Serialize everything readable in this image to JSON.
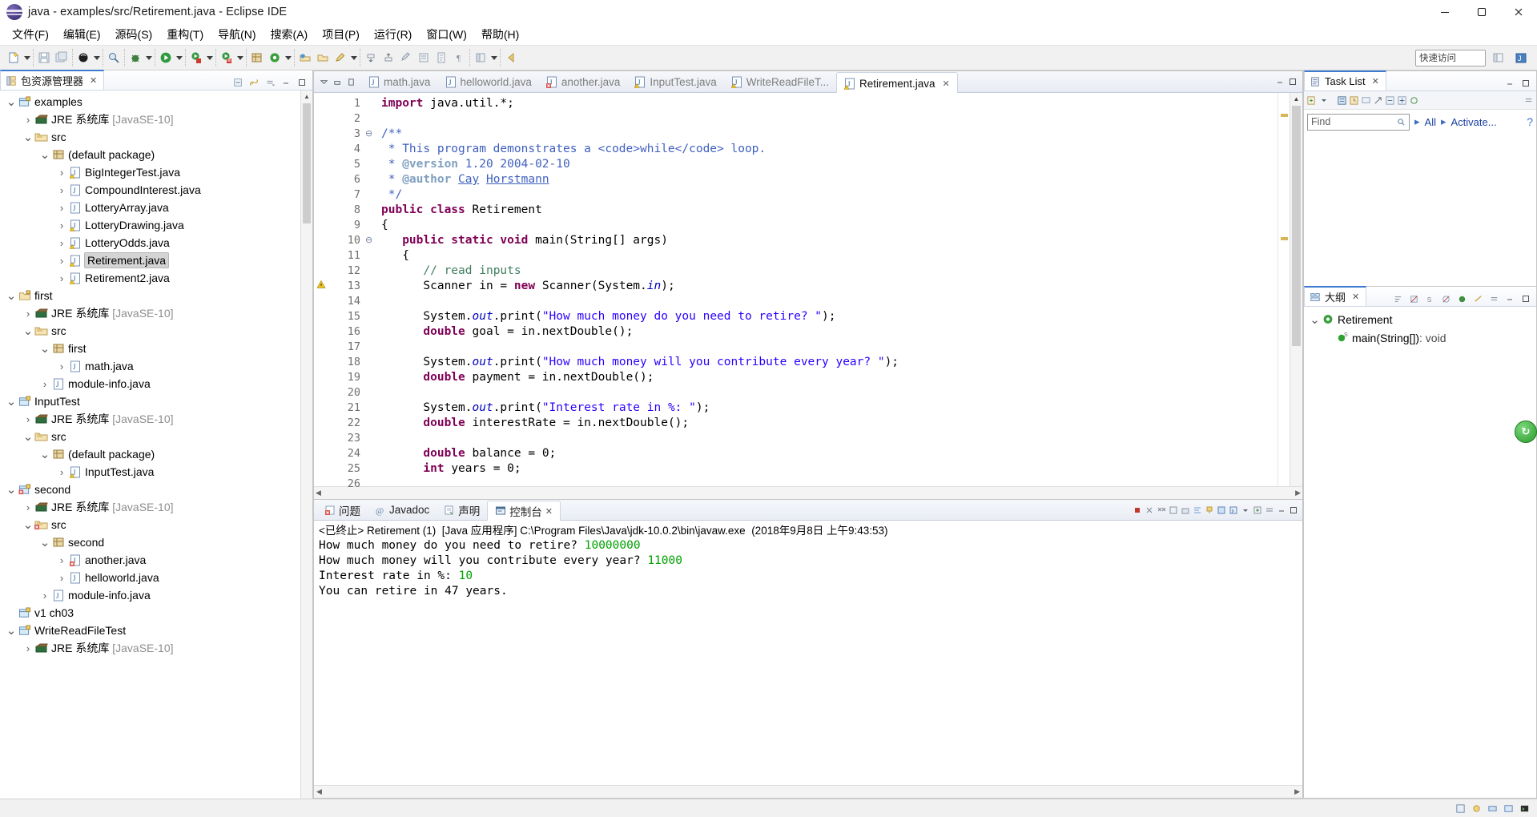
{
  "window": {
    "title": "java - examples/src/Retirement.java - Eclipse IDE",
    "minimize": "–",
    "maximize": "❐",
    "close": "✕"
  },
  "menubar": {
    "items": [
      {
        "label": "文件(F)"
      },
      {
        "label": "编辑(E)"
      },
      {
        "label": "源码(S)"
      },
      {
        "label": "重构(T)"
      },
      {
        "label": "导航(N)"
      },
      {
        "label": "搜索(A)"
      },
      {
        "label": "项目(P)"
      },
      {
        "label": "运行(R)"
      },
      {
        "label": "窗口(W)"
      },
      {
        "label": "帮助(H)"
      }
    ]
  },
  "toolbar": {
    "quick_access": "快速访问",
    "icons": [
      "new-wizard-icon",
      "save-icon",
      "save-all-icon",
      "print-icon",
      "new-java-package-icon",
      "debug-icon",
      "run-icon",
      "coverage-icon",
      "external-tools-icon",
      "new-class-icon",
      "refresh-icon",
      "open-type-icon",
      "search-icon",
      "annotation-icon",
      "previous-annotation-icon",
      "next-annotation-icon",
      "last-edit-icon",
      "back-icon",
      "forward-icon",
      "pin-editor-icon"
    ]
  },
  "explorer": {
    "tab_label": "包资源管理器",
    "tab_close": "✕",
    "tools": [
      "collapse-all-icon",
      "link-with-editor-icon",
      "view-menu-icon",
      "minimize-icon",
      "maximize-icon"
    ],
    "tree": [
      {
        "depth": 0,
        "twist": "⌄",
        "icon": "project-icon",
        "label": "examples",
        "suffix": "",
        "selected": false
      },
      {
        "depth": 1,
        "twist": "›",
        "icon": "jre-library-icon",
        "label": "JRE 系统库",
        "suffix": "[JavaSE-10]",
        "selected": false
      },
      {
        "depth": 1,
        "twist": "⌄",
        "icon": "source-folder-icon",
        "label": "src",
        "suffix": "",
        "selected": false
      },
      {
        "depth": 2,
        "twist": "⌄",
        "icon": "package-icon",
        "label": "(default package)",
        "suffix": "",
        "selected": false
      },
      {
        "depth": 3,
        "twist": "›",
        "icon": "java-file-warn-icon",
        "label": "BigIntegerTest.java",
        "suffix": "",
        "selected": false
      },
      {
        "depth": 3,
        "twist": "›",
        "icon": "java-file-icon",
        "label": "CompoundInterest.java",
        "suffix": "",
        "selected": false
      },
      {
        "depth": 3,
        "twist": "›",
        "icon": "java-file-icon",
        "label": "LotteryArray.java",
        "suffix": "",
        "selected": false
      },
      {
        "depth": 3,
        "twist": "›",
        "icon": "java-file-warn-icon",
        "label": "LotteryDrawing.java",
        "suffix": "",
        "selected": false
      },
      {
        "depth": 3,
        "twist": "›",
        "icon": "java-file-warn-icon",
        "label": "LotteryOdds.java",
        "suffix": "",
        "selected": false
      },
      {
        "depth": 3,
        "twist": "›",
        "icon": "java-file-warn-icon",
        "label": "Retirement.java",
        "suffix": "",
        "selected": true
      },
      {
        "depth": 3,
        "twist": "›",
        "icon": "java-file-warn-icon",
        "label": "Retirement2.java",
        "suffix": "",
        "selected": false
      },
      {
        "depth": 0,
        "twist": "⌄",
        "icon": "project-open-icon",
        "label": "first",
        "suffix": "",
        "selected": false
      },
      {
        "depth": 1,
        "twist": "›",
        "icon": "jre-library-icon",
        "label": "JRE 系统库",
        "suffix": "[JavaSE-10]",
        "selected": false
      },
      {
        "depth": 1,
        "twist": "⌄",
        "icon": "source-folder-icon",
        "label": "src",
        "suffix": "",
        "selected": false
      },
      {
        "depth": 2,
        "twist": "⌄",
        "icon": "package-icon",
        "label": "first",
        "suffix": "",
        "selected": false
      },
      {
        "depth": 3,
        "twist": "›",
        "icon": "java-file-icon",
        "label": "math.java",
        "suffix": "",
        "selected": false
      },
      {
        "depth": 2,
        "twist": "›",
        "icon": "java-file-icon",
        "label": "module-info.java",
        "suffix": "",
        "selected": false
      },
      {
        "depth": 0,
        "twist": "⌄",
        "icon": "project-icon",
        "label": "InputTest",
        "suffix": "",
        "selected": false
      },
      {
        "depth": 1,
        "twist": "›",
        "icon": "jre-library-icon",
        "label": "JRE 系统库",
        "suffix": "[JavaSE-10]",
        "selected": false
      },
      {
        "depth": 1,
        "twist": "⌄",
        "icon": "source-folder-icon",
        "label": "src",
        "suffix": "",
        "selected": false
      },
      {
        "depth": 2,
        "twist": "⌄",
        "icon": "package-icon",
        "label": "(default package)",
        "suffix": "",
        "selected": false
      },
      {
        "depth": 3,
        "twist": "›",
        "icon": "java-file-warn-icon",
        "label": "InputTest.java",
        "suffix": "",
        "selected": false
      },
      {
        "depth": 0,
        "twist": "⌄",
        "icon": "project-error-icon",
        "label": "second",
        "suffix": "",
        "selected": false
      },
      {
        "depth": 1,
        "twist": "›",
        "icon": "jre-library-icon",
        "label": "JRE 系统库",
        "suffix": "[JavaSE-10]",
        "selected": false
      },
      {
        "depth": 1,
        "twist": "⌄",
        "icon": "source-folder-error-icon",
        "label": "src",
        "suffix": "",
        "selected": false
      },
      {
        "depth": 2,
        "twist": "⌄",
        "icon": "package-icon",
        "label": "second",
        "suffix": "",
        "selected": false
      },
      {
        "depth": 3,
        "twist": "›",
        "icon": "java-file-error-icon",
        "label": "another.java",
        "suffix": "",
        "selected": false
      },
      {
        "depth": 3,
        "twist": "›",
        "icon": "java-file-icon",
        "label": "helloworld.java",
        "suffix": "",
        "selected": false
      },
      {
        "depth": 2,
        "twist": "›",
        "icon": "java-file-icon",
        "label": "module-info.java",
        "suffix": "",
        "selected": false
      },
      {
        "depth": 0,
        "twist": "",
        "icon": "project-icon",
        "label": "v1 ch03",
        "suffix": "",
        "selected": false
      },
      {
        "depth": 0,
        "twist": "⌄",
        "icon": "project-icon",
        "label": "WriteReadFileTest",
        "suffix": "",
        "selected": false
      },
      {
        "depth": 1,
        "twist": "›",
        "icon": "jre-library-icon",
        "label": "JRE 系统库",
        "suffix": "[JavaSE-10]",
        "selected": false
      }
    ]
  },
  "editor": {
    "tabs": [
      {
        "label": "math.java",
        "icon": "java-file-icon",
        "active": false
      },
      {
        "label": "helloworld.java",
        "icon": "java-file-icon",
        "active": false
      },
      {
        "label": "another.java",
        "icon": "java-file-error-icon",
        "active": false
      },
      {
        "label": "InputTest.java",
        "icon": "java-file-warn-icon",
        "active": false
      },
      {
        "label": "WriteReadFileT...",
        "icon": "java-file-warn-icon",
        "active": false
      },
      {
        "label": "Retirement.java",
        "icon": "java-file-warn-icon",
        "active": true
      }
    ],
    "tab_close": "✕",
    "minimize": "–",
    "maximize": "❐",
    "left_tools": [
      "show-list-icon",
      "restore-icon",
      "maximize-icon"
    ],
    "lines": [
      {
        "n": "1",
        "fold": "",
        "mark": "",
        "html": "<span class=\"kw\">import</span> java.util.*;"
      },
      {
        "n": "2",
        "fold": "",
        "mark": "",
        "html": ""
      },
      {
        "n": "3",
        "fold": "⊖",
        "mark": "",
        "html": "<span class=\"jdoc\">/**</span>"
      },
      {
        "n": "4",
        "fold": "",
        "mark": "",
        "html": "<span class=\"jdoc\"> * This program demonstrates a &lt;code&gt;while&lt;/code&gt; loop.</span>"
      },
      {
        "n": "5",
        "fold": "",
        "mark": "",
        "html": "<span class=\"jdoc\"> * </span><span class=\"jtag\">@version</span><span class=\"jdoc\"> 1.20 2004-02-10</span>"
      },
      {
        "n": "6",
        "fold": "",
        "mark": "",
        "html": "<span class=\"jdoc\"> * </span><span class=\"jtag\">@author</span><span class=\"jdoc\"> </span><span class=\"jdoc ulink\">Cay</span><span class=\"jdoc\"> </span><span class=\"jdoc ulink\">Horstmann</span>"
      },
      {
        "n": "7",
        "fold": "",
        "mark": "",
        "html": "<span class=\"jdoc\"> */</span>"
      },
      {
        "n": "8",
        "fold": "",
        "mark": "",
        "html": "<span class=\"kw\">public class</span> Retirement"
      },
      {
        "n": "9",
        "fold": "",
        "mark": "",
        "html": "{"
      },
      {
        "n": "10",
        "fold": "⊖",
        "mark": "",
        "html": "   <span class=\"kw\">public static void</span> main(String[] args)"
      },
      {
        "n": "11",
        "fold": "",
        "mark": "",
        "html": "   {"
      },
      {
        "n": "12",
        "fold": "",
        "mark": "",
        "html": "      <span class=\"cmt\">// read inputs</span>"
      },
      {
        "n": "13",
        "fold": "",
        "mark": "warn",
        "html": "      Scanner <span>in</span> = <span class=\"kw\">new</span> Scanner(System.<span class=\"fld\">in</span>);"
      },
      {
        "n": "14",
        "fold": "",
        "mark": "",
        "html": ""
      },
      {
        "n": "15",
        "fold": "",
        "mark": "",
        "html": "      System.<span class=\"fld\">out</span>.print(<span class=\"str\">\"How much money do you need to retire? \"</span>);"
      },
      {
        "n": "16",
        "fold": "",
        "mark": "",
        "html": "      <span class=\"kw\">double</span> goal = in.nextDouble();"
      },
      {
        "n": "17",
        "fold": "",
        "mark": "",
        "html": ""
      },
      {
        "n": "18",
        "fold": "",
        "mark": "",
        "html": "      System.<span class=\"fld\">out</span>.print(<span class=\"str\">\"How much money will you contribute every year? \"</span>);"
      },
      {
        "n": "19",
        "fold": "",
        "mark": "",
        "html": "      <span class=\"kw\">double</span> payment = in.nextDouble();"
      },
      {
        "n": "20",
        "fold": "",
        "mark": "",
        "html": ""
      },
      {
        "n": "21",
        "fold": "",
        "mark": "",
        "html": "      System.<span class=\"fld\">out</span>.print(<span class=\"str\">\"Interest rate in %: \"</span>);"
      },
      {
        "n": "22",
        "fold": "",
        "mark": "",
        "html": "      <span class=\"kw\">double</span> interestRate = in.nextDouble();"
      },
      {
        "n": "23",
        "fold": "",
        "mark": "",
        "html": ""
      },
      {
        "n": "24",
        "fold": "",
        "mark": "",
        "html": "      <span class=\"kw\">double</span> balance = <span>0</span>;"
      },
      {
        "n": "25",
        "fold": "",
        "mark": "",
        "html": "      <span class=\"kw\">int</span> years = <span>0</span>;"
      },
      {
        "n": "26",
        "fold": "",
        "mark": "",
        "html": ""
      }
    ]
  },
  "console": {
    "tabs": [
      {
        "label": "问题",
        "icon": "problems-icon",
        "active": false
      },
      {
        "label": "Javadoc",
        "icon": "javadoc-icon",
        "active": false
      },
      {
        "label": "声明",
        "icon": "declaration-icon",
        "active": false
      },
      {
        "label": "控制台",
        "icon": "console-icon",
        "active": true
      }
    ],
    "tab_close": "✕",
    "tools": [
      "terminate-icon",
      "remove-launch-icon",
      "remove-all-icon",
      "clear-console-icon",
      "scroll-lock-icon",
      "word-wrap-icon",
      "pin-console-icon",
      "display-selected-icon",
      "open-console-icon",
      "new-console-view-icon",
      "view-menu-icon",
      "minimize-icon",
      "maximize-icon"
    ],
    "header": "<已终止> Retirement (1)  [Java 应用程序] C:\\Program Files\\Java\\jdk-10.0.2\\bin\\javaw.exe  (2018年9月8日 上午9:43:53)",
    "output": [
      {
        "prompt": "How much money do you need to retire? ",
        "input": "10000000"
      },
      {
        "prompt": "How much money will you contribute every year? ",
        "input": "11000"
      },
      {
        "prompt": "Interest rate in %: ",
        "input": "10"
      },
      {
        "prompt": "You can retire in 47 years.",
        "input": ""
      }
    ]
  },
  "tasklist": {
    "tab_label": "Task List",
    "tab_close": "✕",
    "find_placeholder": "Find",
    "find_value": "",
    "all_label": "All",
    "activate_label": "Activate...",
    "help_icon": "help-icon",
    "tools": [
      "new-task-icon",
      "categorize-icon",
      "schedule-icon",
      "focus-icon",
      "collapse-all-icon",
      "expand-all-icon",
      "synchronize-icon",
      "view-menu-icon",
      "minimize-icon",
      "maximize-icon"
    ]
  },
  "outline": {
    "tab_label": "大纲",
    "tab_close": "✕",
    "tools": [
      "sort-icon",
      "hide-fields-icon",
      "hide-static-icon",
      "hide-nonpublic-icon",
      "link-icon",
      "focus-icon",
      "view-menu-icon",
      "minimize-icon",
      "maximize-icon"
    ],
    "rows": [
      {
        "depth": 0,
        "twist": "⌄",
        "icon": "java-class-icon",
        "label": "Retirement",
        "suffix": ""
      },
      {
        "depth": 1,
        "twist": "",
        "icon": "java-method-icon",
        "label": "main(String[])",
        "suffix": ": void"
      }
    ]
  },
  "floating": {
    "label": "↻",
    "name": "refresh-floating-button"
  },
  "statusbar": {
    "icons": [
      "writable-icon",
      "smart-insert-icon",
      "heap-status-icon",
      "build-icon",
      "terminal-icon"
    ]
  },
  "colors": {
    "accent": "#3d7bd0",
    "keyword": "#7f0055",
    "string": "#2a00ff",
    "comment": "#3f7f5f",
    "javadoc": "#3f5fbf",
    "field": "#0000c0",
    "console_input": "#00a000",
    "selection": "#d4d4d4"
  }
}
